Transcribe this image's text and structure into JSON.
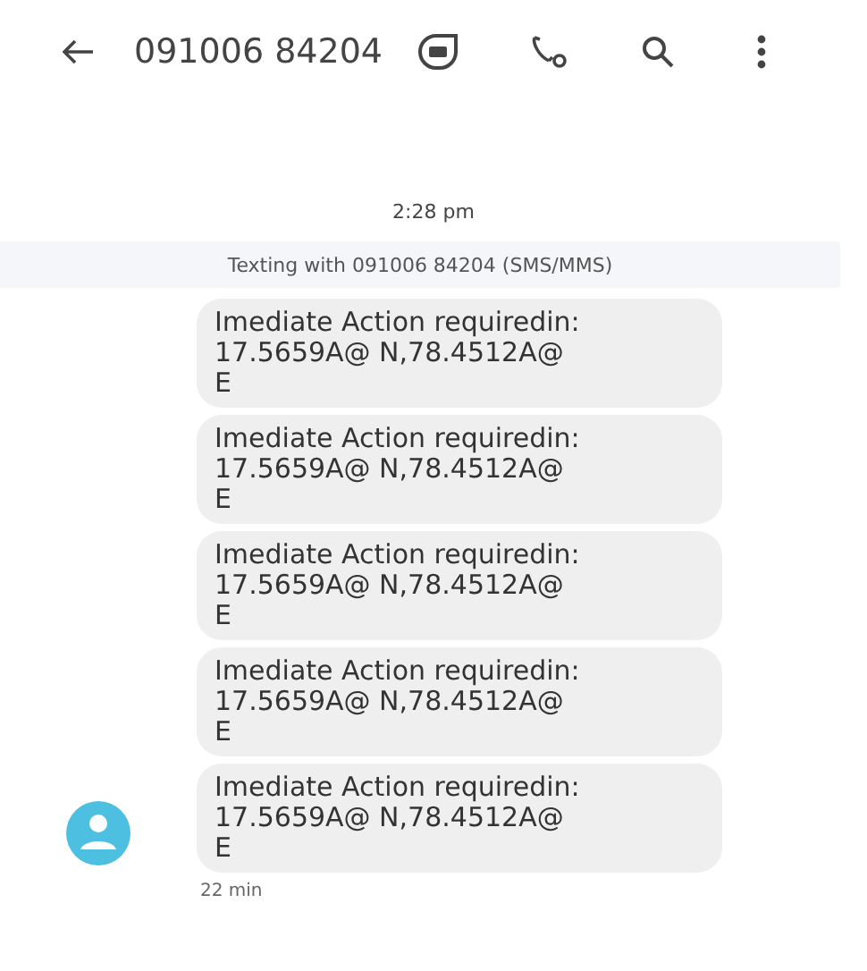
{
  "header": {
    "title": "091006 84204"
  },
  "timestamp": "2:28 pm",
  "banner": "Texting with 091006 84204 (SMS/MMS)",
  "messages": [
    {
      "text": "Imediate Action requiredin:\n17.5659A@ N,78.4512A@\nE"
    },
    {
      "text": "Imediate Action requiredin:\n17.5659A@ N,78.4512A@\nE"
    },
    {
      "text": "Imediate Action requiredin:\n17.5659A@ N,78.4512A@\nE"
    },
    {
      "text": "Imediate Action requiredin:\n17.5659A@ N,78.4512A@\nE"
    },
    {
      "text": "Imediate Action requiredin:\n17.5659A@ N,78.4512A@\nE"
    }
  ],
  "footer_time": "22 min"
}
